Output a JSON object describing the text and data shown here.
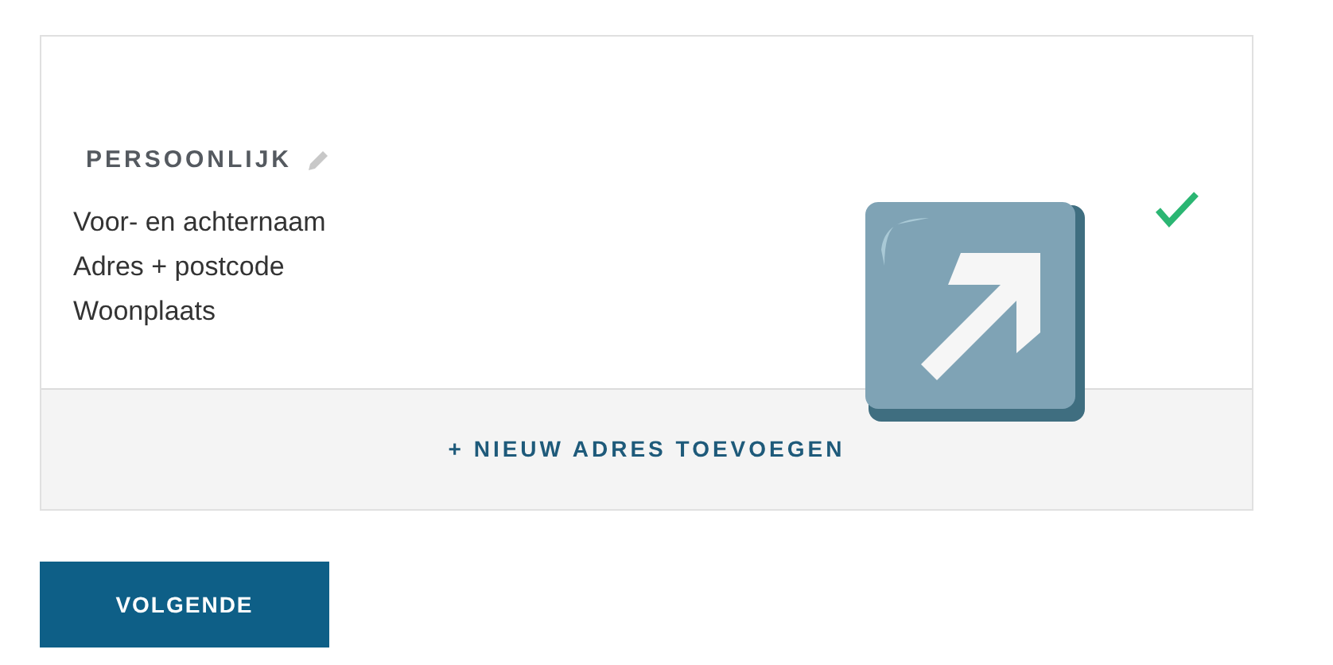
{
  "card": {
    "title": "PERSOONLIJK",
    "fields": [
      "Voor- en achternaam",
      "Adres + postcode",
      "Woonplaats"
    ],
    "checked": true,
    "add_link": "+ NIEUW ADRES TOEVOEGEN"
  },
  "next_button": "VOLGENDE"
}
